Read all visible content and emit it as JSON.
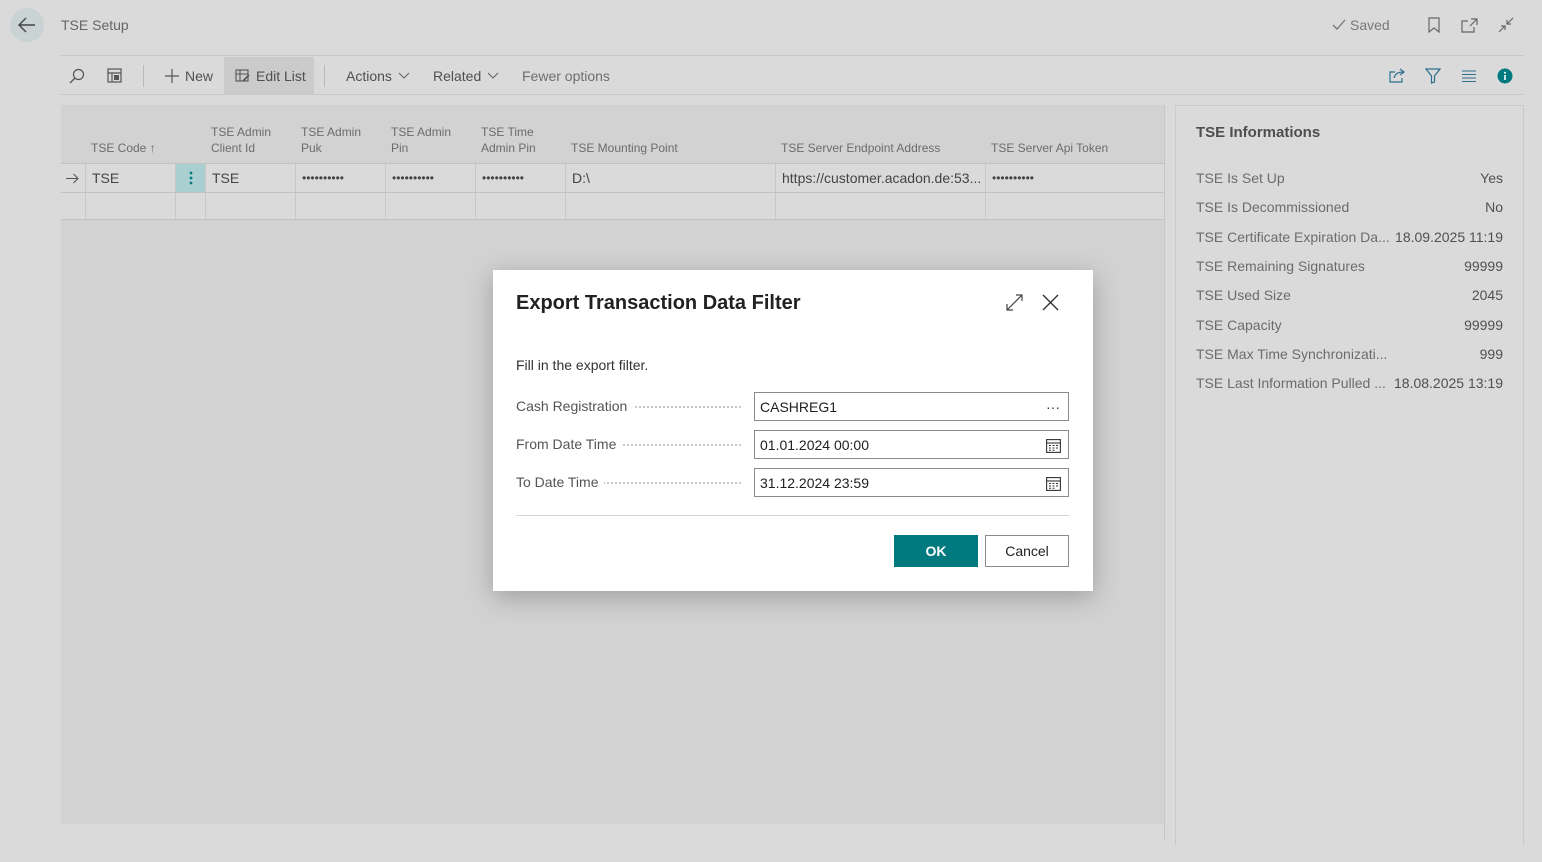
{
  "page": {
    "title": "TSE Setup",
    "status": "Saved"
  },
  "actionbar": {
    "new_label": "New",
    "edit_list_label": "Edit List",
    "actions_label": "Actions",
    "related_label": "Related",
    "fewer_options_label": "Fewer options"
  },
  "list": {
    "columns": [
      "TSE Code ↑",
      "TSE Admin Client Id",
      "TSE Admin Puk",
      "TSE Admin Pin",
      "TSE Time Admin Pin",
      "TSE Mounting Point",
      "TSE Server Endpoint Address",
      "TSE Server Api Token"
    ],
    "columns_lines": [
      [
        "TSE Code ↑"
      ],
      [
        "TSE Admin",
        "Client Id"
      ],
      [
        "TSE Admin",
        "Puk"
      ],
      [
        "TSE Admin",
        "Pin"
      ],
      [
        "TSE Time",
        "Admin Pin"
      ],
      [
        "TSE Mounting Point"
      ],
      [
        "TSE Server Endpoint Address"
      ],
      [
        "TSE Server Api Token"
      ]
    ],
    "rows": [
      {
        "code": "TSE",
        "admin_client_id": "TSE",
        "admin_puk": "••••••••••",
        "admin_pin": "••••••••••",
        "time_admin_pin": "••••••••••",
        "mounting_point": "D:\\",
        "endpoint_address": "https://customer.acadon.de:53...",
        "api_token": "••••••••••"
      }
    ]
  },
  "factbox": {
    "title": "TSE Informations",
    "items": [
      {
        "label": "TSE Is Set Up",
        "value": "Yes"
      },
      {
        "label": "TSE Is Decommissioned",
        "value": "No"
      },
      {
        "label": "TSE Certificate Expiration Da...",
        "value": "18.09.2025 11:19"
      },
      {
        "label": "TSE Remaining Signatures",
        "value": "99999"
      },
      {
        "label": "TSE Used Size",
        "value": "2045"
      },
      {
        "label": "TSE Capacity",
        "value": "99999"
      },
      {
        "label": "TSE Max Time Synchronizati...",
        "value": "999"
      },
      {
        "label": "TSE Last Information Pulled ...",
        "value": "18.08.2025 13:19"
      }
    ]
  },
  "dialog": {
    "title": "Export Transaction Data Filter",
    "instruction": "Fill in the export filter.",
    "fields": [
      {
        "label": "Cash Registration",
        "value": "CASHREG1",
        "button": "lookup"
      },
      {
        "label": "From Date Time",
        "value": "01.01.2024 00:00",
        "button": "calendar"
      },
      {
        "label": "To Date Time",
        "value": "31.12.2024 23:59",
        "button": "calendar"
      }
    ],
    "ok_label": "OK",
    "cancel_label": "Cancel",
    "lookup_glyph": "···"
  },
  "colors": {
    "accent": "#00797f",
    "selection": "#a9cfd1"
  }
}
